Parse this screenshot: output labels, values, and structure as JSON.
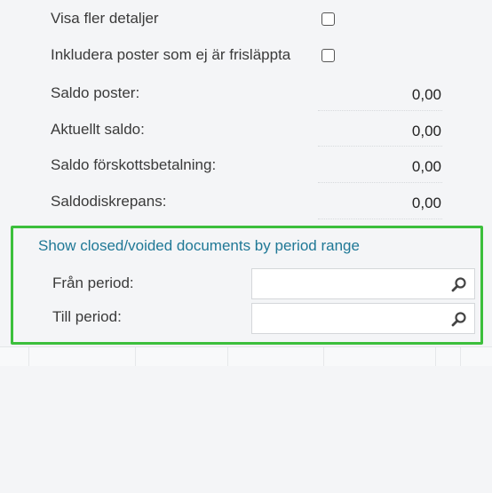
{
  "options": {
    "show_more_details": "Visa fler detaljer",
    "include_unreleased": "Inkludera poster som ej är frisläppta"
  },
  "balances": [
    {
      "label": "Saldo poster:",
      "value": "0,00"
    },
    {
      "label": "Aktuellt saldo:",
      "value": "0,00"
    },
    {
      "label": "Saldo förskottsbetalning:",
      "value": "0,00"
    },
    {
      "label": "Saldodiskrepans:",
      "value": "0,00"
    }
  ],
  "period_range": {
    "title": "Show closed/voided documents by period range",
    "from_label": "Från period:",
    "from_value": "",
    "to_label": "Till period:",
    "to_value": ""
  },
  "icons": {
    "lookup": "search-icon",
    "checkbox": "checkbox-unchecked"
  },
  "colors": {
    "link": "#1f7896",
    "highlight_border": "#3cbf3c"
  }
}
